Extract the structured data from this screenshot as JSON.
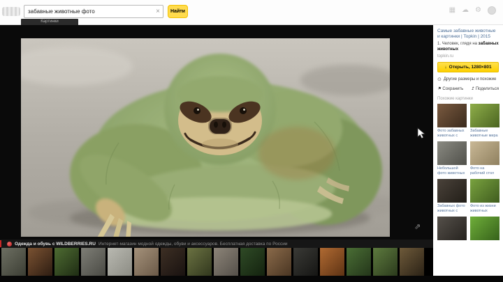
{
  "header": {
    "search_value": "забавные животные фото",
    "clear_icon": "×",
    "find_button": "Найти",
    "icons": {
      "grid": "▦",
      "cloud": "☁",
      "gear": "⚙"
    },
    "pictures_tab": "Картинки"
  },
  "viewer": {
    "expand_icon": "⇗"
  },
  "ad_bar": {
    "title": "Одежда и обувь с WILDBERRIES.RU",
    "text": "Интернет-магазин модной одежды, обуви и аксессуаров. Бесплатная доставка по России"
  },
  "sidebar": {
    "title": "Самые забавные животные и картинки | Topkin | 2015",
    "snippet_prefix": "1. Человек, глядя на ",
    "snippet_bold": "забавных животных",
    "domain": "topkin.ru",
    "open_button": "Открыть, 1280×801",
    "download_icon": "↓",
    "other_sizes": "Другие размеры и похожие",
    "other_sizes_icon": "⊙",
    "save": "Сохранить",
    "save_icon": "⚑",
    "share": "Поделиться",
    "share_icon": "↥",
    "similar_heading": "Похожие картинки",
    "similar": [
      {
        "caption": "Фото забавных животных с",
        "c1": "#7a5a40",
        "c2": "#3a2a1c"
      },
      {
        "caption": "Забавные животные мира",
        "c1": "#8fae4a",
        "c2": "#4a6420"
      },
      {
        "caption": "Небольшой фото животных",
        "c1": "#8a8a82",
        "c2": "#50504a"
      },
      {
        "caption": "Фото на рабочий стол",
        "c1": "#c9b896",
        "c2": "#8f805f"
      },
      {
        "caption": "Забавных фото животных с",
        "c1": "#4a423a",
        "c2": "#221e18"
      },
      {
        "caption": "Фото из жизни животных",
        "c1": "#79a23f",
        "c2": "#3f5c1e"
      },
      {
        "caption": "",
        "c1": "#55504a",
        "c2": "#26231f"
      },
      {
        "caption": "",
        "c1": "#6fae3a",
        "c2": "#36621a"
      }
    ]
  },
  "filmstrip": {
    "thumbs": [
      {
        "c1": "#6d6f62",
        "c2": "#3c3e34"
      },
      {
        "c1": "#7a5232",
        "c2": "#2e1d12"
      },
      {
        "c1": "#4e6b32",
        "c2": "#1f2d14"
      },
      {
        "c1": "#7e7e76",
        "c2": "#4a4a44"
      },
      {
        "c1": "#b9b9b1",
        "c2": "#8c8c84"
      },
      {
        "c1": "#a4917a",
        "c2": "#6b5a48"
      },
      {
        "c1": "#3d2f24",
        "c2": "#191210"
      },
      {
        "c1": "#6b7242",
        "c2": "#32381e"
      },
      {
        "c1": "#8c8478",
        "c2": "#55504a"
      },
      {
        "c1": "#2f4a26",
        "c2": "#14230f"
      },
      {
        "c1": "#8a6a4a",
        "c2": "#4a3623"
      },
      {
        "c1": "#3a3a36",
        "c2": "#161614"
      },
      {
        "c1": "#b06a32",
        "c2": "#5e3314"
      },
      {
        "c1": "#4a6e35",
        "c2": "#24361a"
      },
      {
        "c1": "#5d7a3e",
        "c2": "#2c3b1d"
      },
      {
        "c1": "#6e5a3a",
        "c2": "#2b2216"
      }
    ]
  },
  "colors": {
    "accent_yellow": "#ffdb4d",
    "link_blue": "#4a6d96",
    "viewer_bg": "#0a0a0a"
  }
}
